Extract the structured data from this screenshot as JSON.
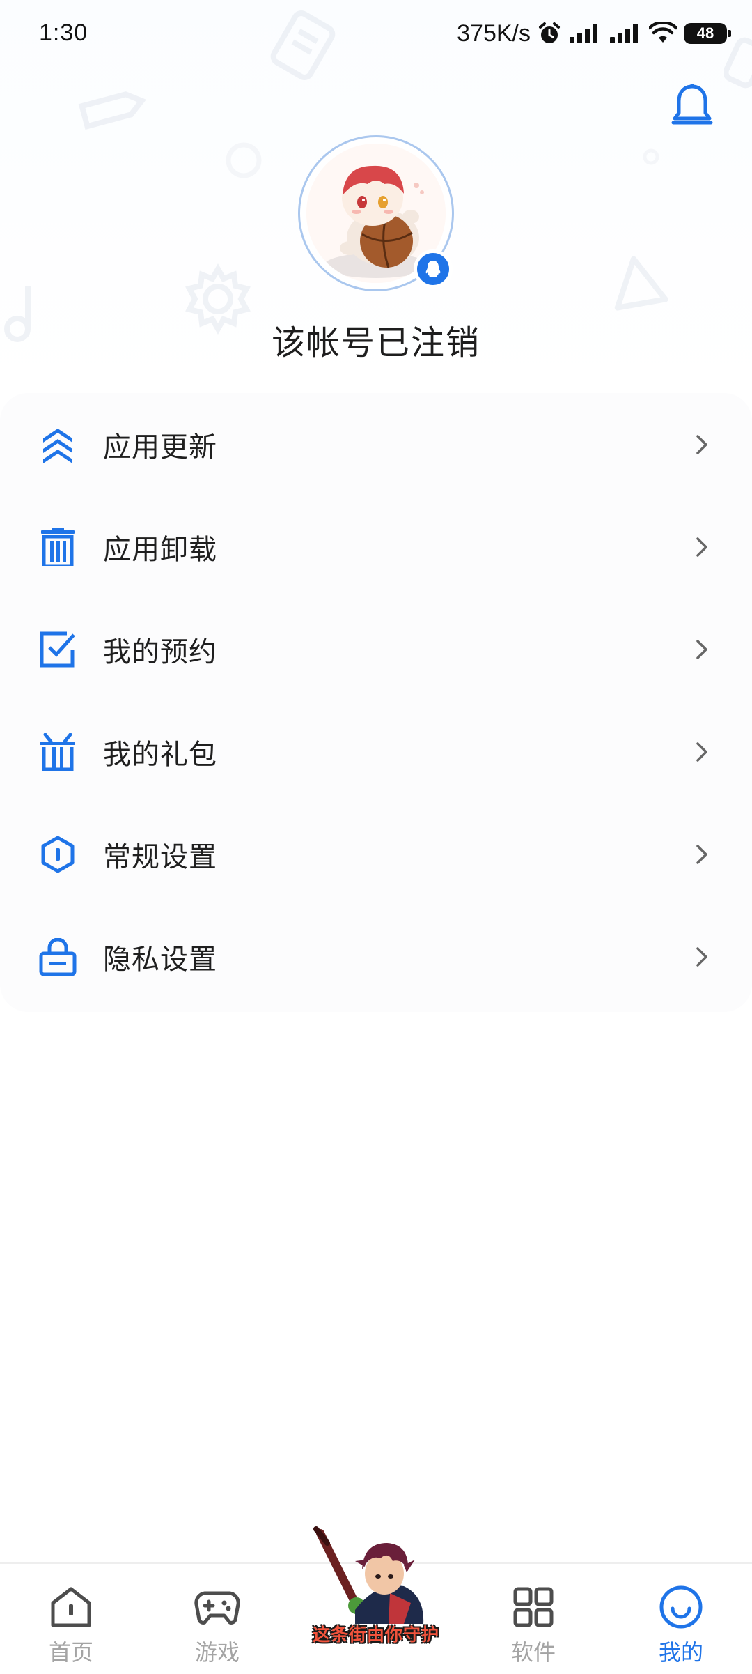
{
  "status_bar": {
    "time": "1:30",
    "net_speed": "375K/s",
    "battery": "48",
    "icons": [
      "alarm-icon",
      "signal-icon",
      "signal-icon",
      "wifi-icon",
      "battery-icon"
    ]
  },
  "header": {
    "bell_icon": "bell-icon",
    "username": "该帐号已注销",
    "avatar_badge_icon": "qq-icon"
  },
  "menu": {
    "items": [
      {
        "label": "应用更新",
        "icon": "update-chevrons-icon"
      },
      {
        "label": "应用卸载",
        "icon": "trash-icon"
      },
      {
        "label": "我的预约",
        "icon": "checkbox-icon"
      },
      {
        "label": "我的礼包",
        "icon": "gift-icon"
      },
      {
        "label": "常规设置",
        "icon": "hexagon-settings-icon"
      },
      {
        "label": "隐私设置",
        "icon": "lock-icon"
      }
    ]
  },
  "bottom_nav": {
    "items": [
      {
        "label": "首页",
        "icon": "home-icon",
        "active": false
      },
      {
        "label": "游戏",
        "icon": "gamepad-icon",
        "active": false
      },
      {
        "label": "软件",
        "icon": "grid-icon",
        "active": false
      },
      {
        "label": "我的",
        "icon": "smile-icon",
        "active": true
      }
    ],
    "promo_text": "这条街由你守护"
  },
  "colors": {
    "accent": "#1f74e8",
    "inactive": "#a4a4a4",
    "text": "#1f1f1f"
  }
}
